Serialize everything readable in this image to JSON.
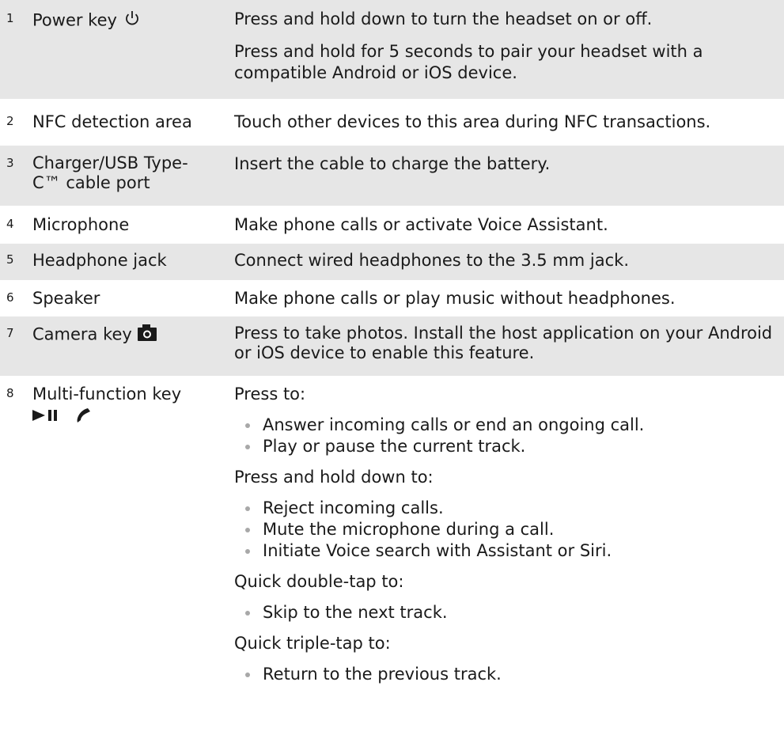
{
  "rows": [
    {
      "num": "1",
      "name": "Power key",
      "icon": "power-icon",
      "desc": [
        "Press and hold down to turn the headset on or off.",
        "Press and hold for 5 seconds to pair your headset with a compatible Android or iOS device."
      ]
    },
    {
      "num": "2",
      "name": "NFC detection area",
      "desc": [
        "Touch other devices to this area during NFC transactions."
      ]
    },
    {
      "num": "3",
      "name": "Charger/USB Type-C™ cable port",
      "desc": [
        "Insert the cable to charge the battery."
      ]
    },
    {
      "num": "4",
      "name": "Microphone",
      "desc": [
        "Make phone calls or activate Voice Assistant."
      ]
    },
    {
      "num": "5",
      "name": "Headphone jack",
      "desc": [
        "Connect wired headphones to the 3.5 mm jack."
      ]
    },
    {
      "num": "6",
      "name": "Speaker",
      "desc": [
        "Make phone calls or play music without headphones."
      ]
    },
    {
      "num": "7",
      "name": "Camera key",
      "icon": "camera-icon",
      "desc": [
        "Press to take photos. Install the host application on your Android or iOS device to enable this feature."
      ]
    },
    {
      "num": "8",
      "name": "Multi-function key",
      "icons": [
        "play-pause-icon",
        "phone-handset-icon"
      ],
      "sections": [
        {
          "heading": "Press to:",
          "bullets": [
            "Answer incoming calls or end an ongoing call.",
            "Play or pause the current track."
          ]
        },
        {
          "heading": "Press and hold down to:",
          "bullets": [
            "Reject incoming calls.",
            "Mute the microphone during a call.",
            "Initiate Voice search with Assistant or Siri."
          ]
        },
        {
          "heading": "Quick double-tap to:",
          "bullets": [
            "Skip to the next track."
          ]
        },
        {
          "heading": "Quick triple-tap to:",
          "bullets": [
            "Return to the previous track."
          ]
        }
      ]
    }
  ],
  "colors": {
    "shaded_row": "#e6e6e6",
    "text": "#1a1a1a",
    "bullet": "#a8a8a8"
  }
}
